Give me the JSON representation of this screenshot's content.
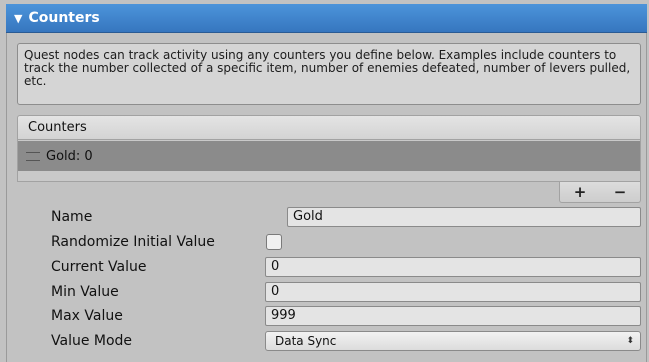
{
  "header": {
    "collapse_glyph": "▼",
    "title": "Counters"
  },
  "help_text": "Quest nodes can track activity using any counters you define below. Examples include counters to track the number collected of a specific item, number of enemies defeated, number of levers pulled, etc.",
  "list": {
    "header_label": "Counters",
    "items": [
      {
        "label": "Gold: 0",
        "selected": true
      }
    ],
    "add_label": "+",
    "remove_label": "−"
  },
  "properties": {
    "name_label": "Name",
    "name_value": "Gold",
    "randomize_label": "Randomize Initial Value",
    "randomize_checked": false,
    "current_label": "Current Value",
    "current_value": "0",
    "min_label": "Min Value",
    "min_value": "0",
    "max_label": "Max Value",
    "max_value": "999",
    "mode_label": "Value Mode",
    "mode_value": "Data Sync",
    "mode_caret": "⬍"
  },
  "colors": {
    "header_blue": "#3f86cf",
    "panel_gray": "#c2c2c2",
    "selected_row": "#8b8b8b"
  }
}
